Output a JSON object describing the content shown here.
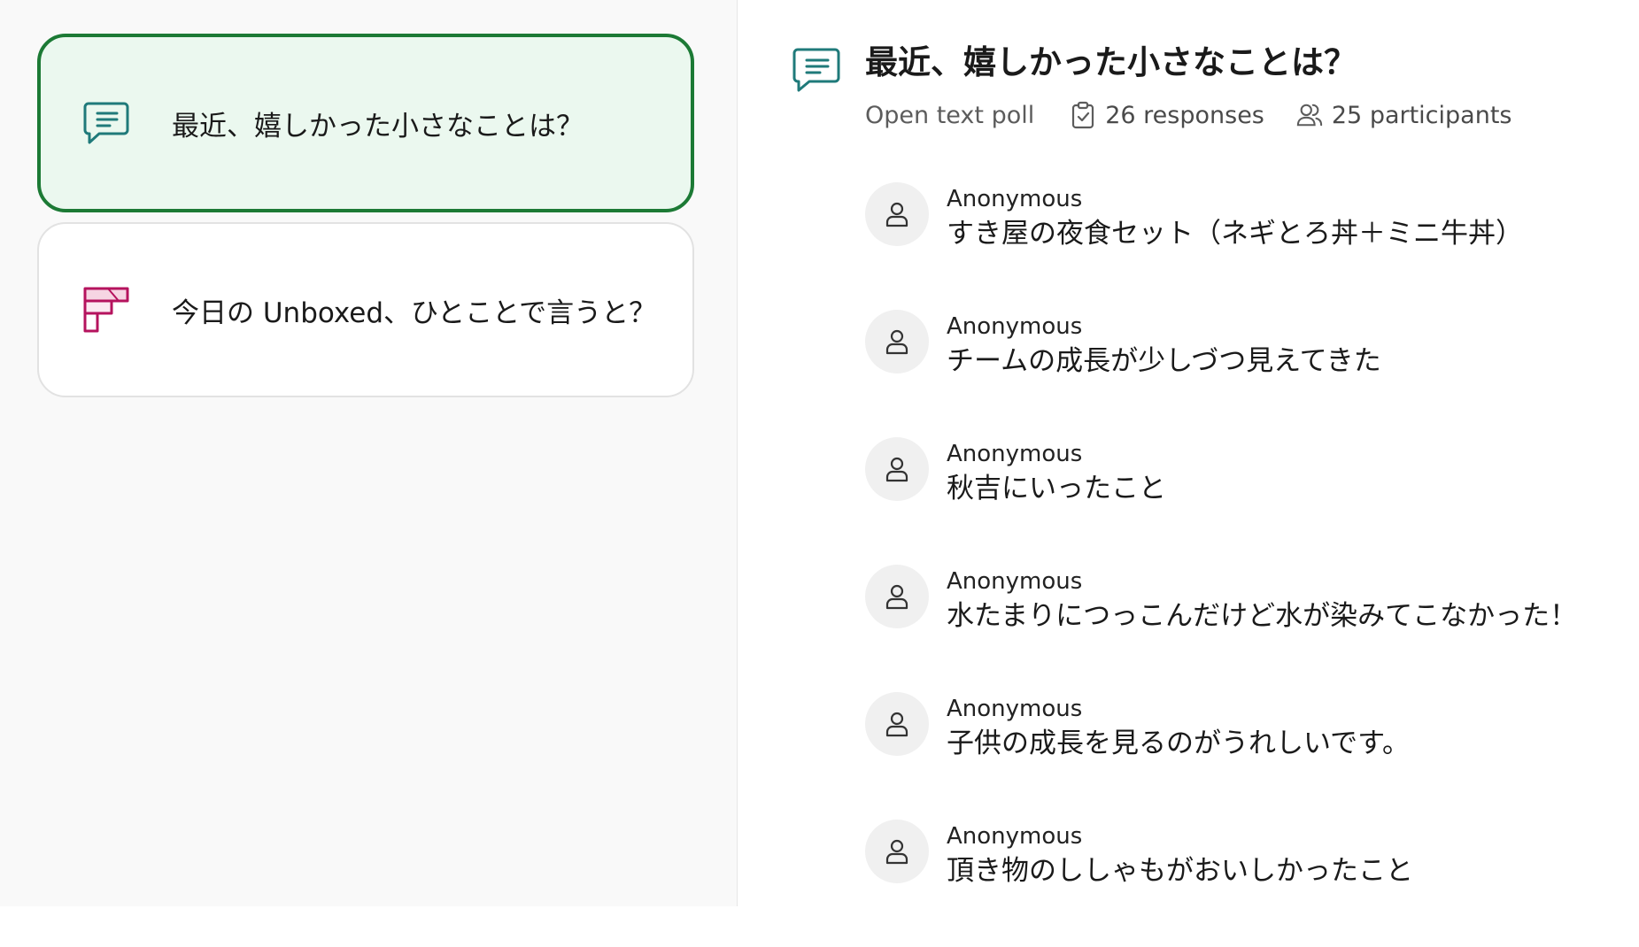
{
  "sidebar": {
    "polls": [
      {
        "title": "最近、嬉しかった小さなことは？",
        "icon": "chat-bubble-icon",
        "color": "#1f7a7a",
        "active": true
      },
      {
        "title": "今日の Unboxed、ひとことで言うと？",
        "icon": "ranking-icon",
        "color": "#b5135e",
        "active": false
      }
    ]
  },
  "main": {
    "icon": "chat-bubble-icon",
    "title": "最近、嬉しかった小さなことは？",
    "poll_type": "Open text poll",
    "responses_count": "26 responses",
    "participants_count": "25 participants",
    "responses": [
      {
        "author": "Anonymous",
        "text": "すき屋の夜食セット（ネギとろ丼＋ミニ牛丼）"
      },
      {
        "author": "Anonymous",
        "text": "チームの成長が少しづつ見えてきた"
      },
      {
        "author": "Anonymous",
        "text": "秋吉にいったこと"
      },
      {
        "author": "Anonymous",
        "text": "水たまりにつっこんだけど水が染みてこなかった！"
      },
      {
        "author": "Anonymous",
        "text": "子供の成長を見るのがうれしいです。"
      },
      {
        "author": "Anonymous",
        "text": "頂き物のししゃもがおいしかったこと"
      }
    ]
  },
  "colors": {
    "active_card_bg": "#ebf8ef",
    "active_card_border": "#1c7a35",
    "teal_icon": "#1f7a7a",
    "magenta_icon": "#b5135e"
  }
}
